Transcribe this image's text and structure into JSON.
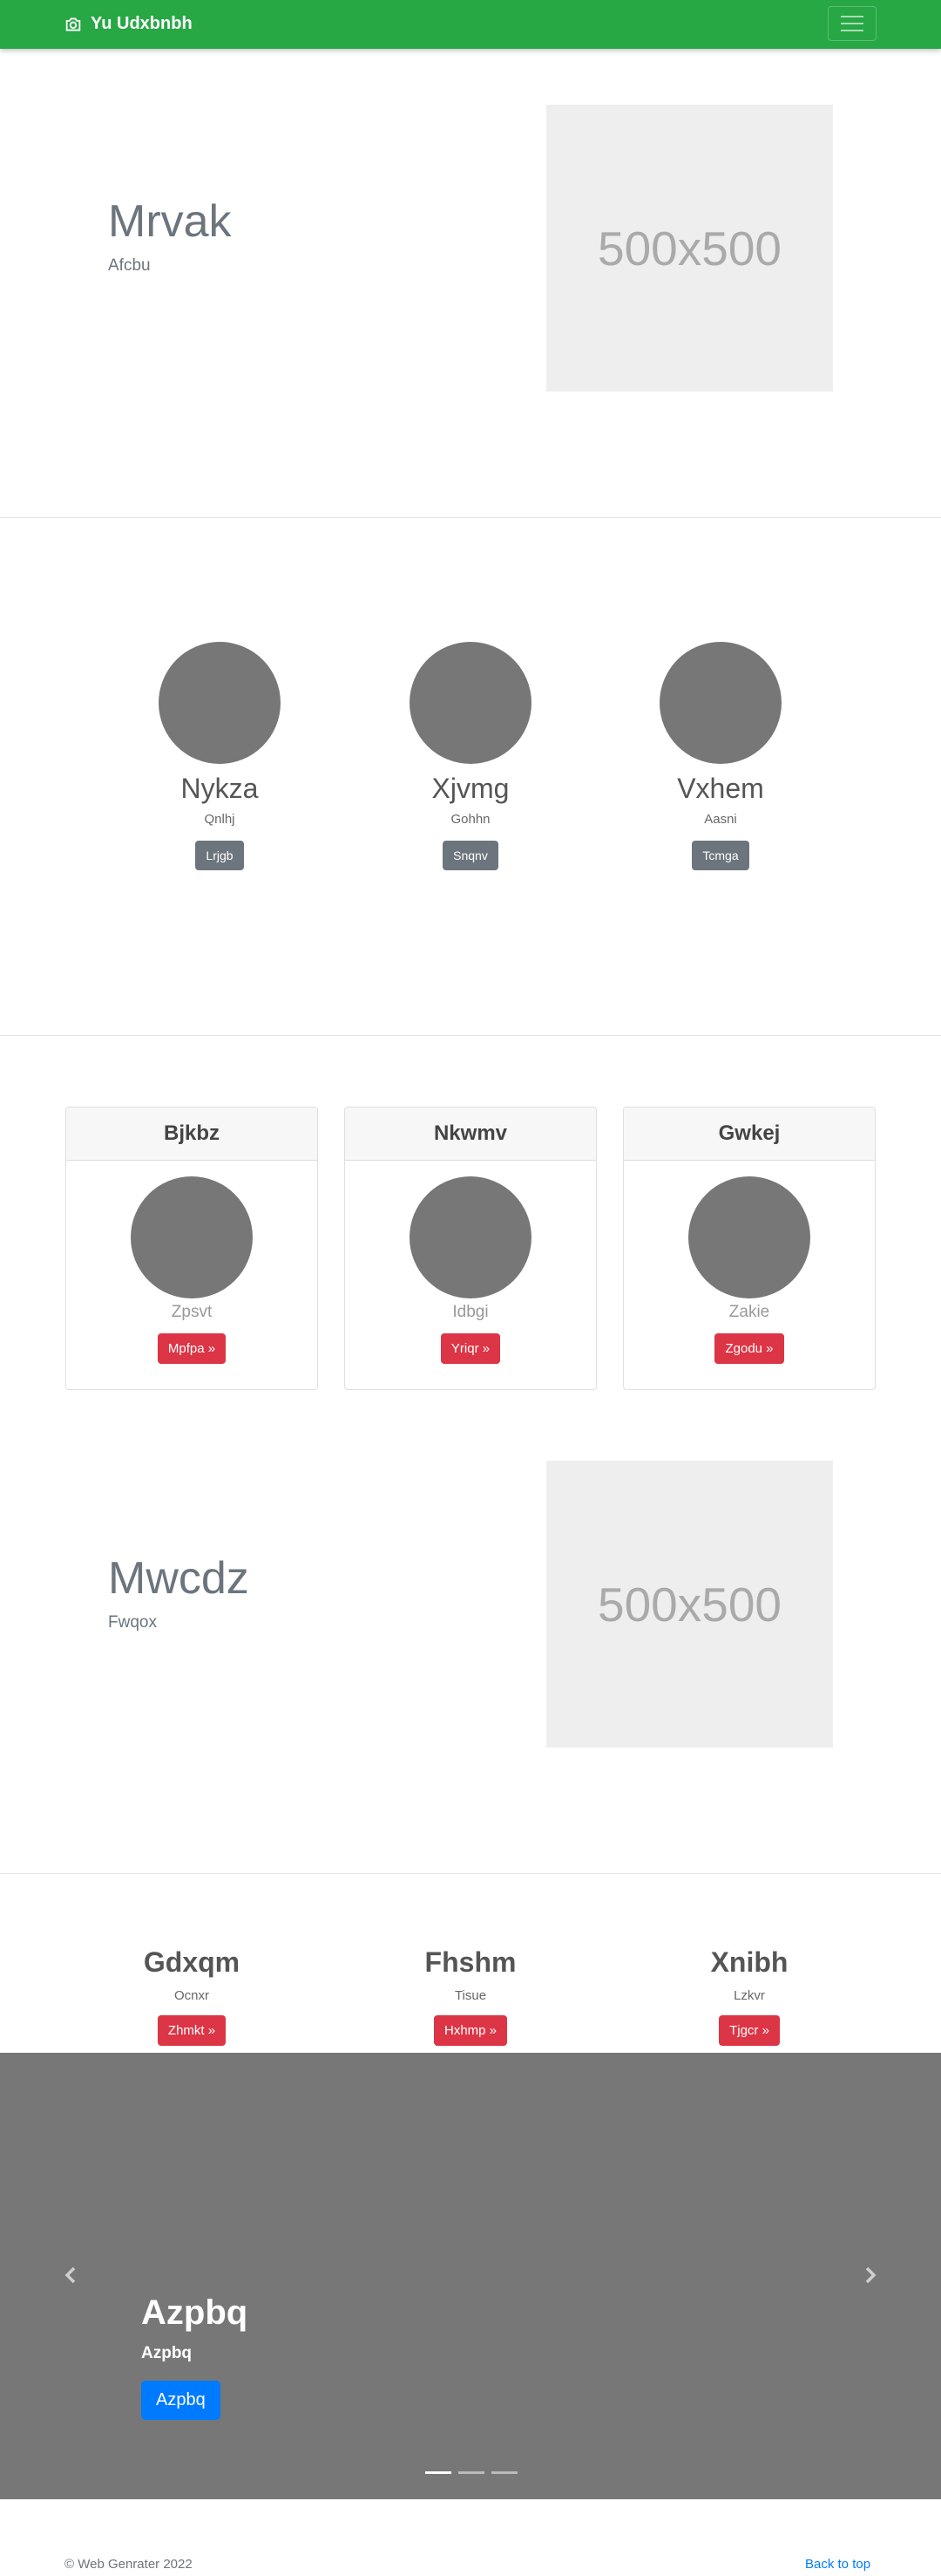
{
  "navbar": {
    "brand": "Yu Udxbnbh",
    "brand_icon": "camera-icon",
    "toggler_icon": "hamburger-menu-icon"
  },
  "featurette1": {
    "heading": "Mrvak",
    "subtext": "Afcbu",
    "image_label": "500x500"
  },
  "circles": [
    {
      "title": "Nykza",
      "text": "Qnlhj",
      "button": "Lrjgb"
    },
    {
      "title": "Xjvmg",
      "text": "Gohhn",
      "button": "Snqnv"
    },
    {
      "title": "Vxhem",
      "text": "Aasni",
      "button": "Tcmga"
    }
  ],
  "cards": [
    {
      "header": "Bjkbz",
      "text": "Zpsvt",
      "button": "Mpfpa »"
    },
    {
      "header": "Nkwmv",
      "text": "Idbgi",
      "button": "Yriqr »"
    },
    {
      "header": "Gwkej",
      "text": "Zakie",
      "button": "Zgodu »"
    }
  ],
  "featurette2": {
    "heading": "Mwcdz",
    "subtext": "Fwqox",
    "image_label": "500x500"
  },
  "text_columns": [
    {
      "title": "Gdxqm",
      "text": "Ocnxr",
      "button": "Zhmkt »"
    },
    {
      "title": "Fhshm",
      "text": "Tisue",
      "button": "Hxhmp »"
    },
    {
      "title": "Xnibh",
      "text": "Lzkvr",
      "button": "Tjgcr »"
    }
  ],
  "carousel": {
    "title": "Azpbq",
    "subtitle": "Azpbq",
    "button": "Azpbq",
    "prev_icon": "chevron-left-icon",
    "next_icon": "chevron-right-icon",
    "slide_count": 3,
    "active_slide": 1
  },
  "footer": {
    "copyright": "© Web Genrater 2022",
    "back_to_top": "Back to top"
  },
  "colors": {
    "navbar": "#28a745",
    "danger": "#dc3545",
    "primary": "#007bff",
    "secondary": "#6c757d",
    "carousel_bg": "#777777"
  }
}
